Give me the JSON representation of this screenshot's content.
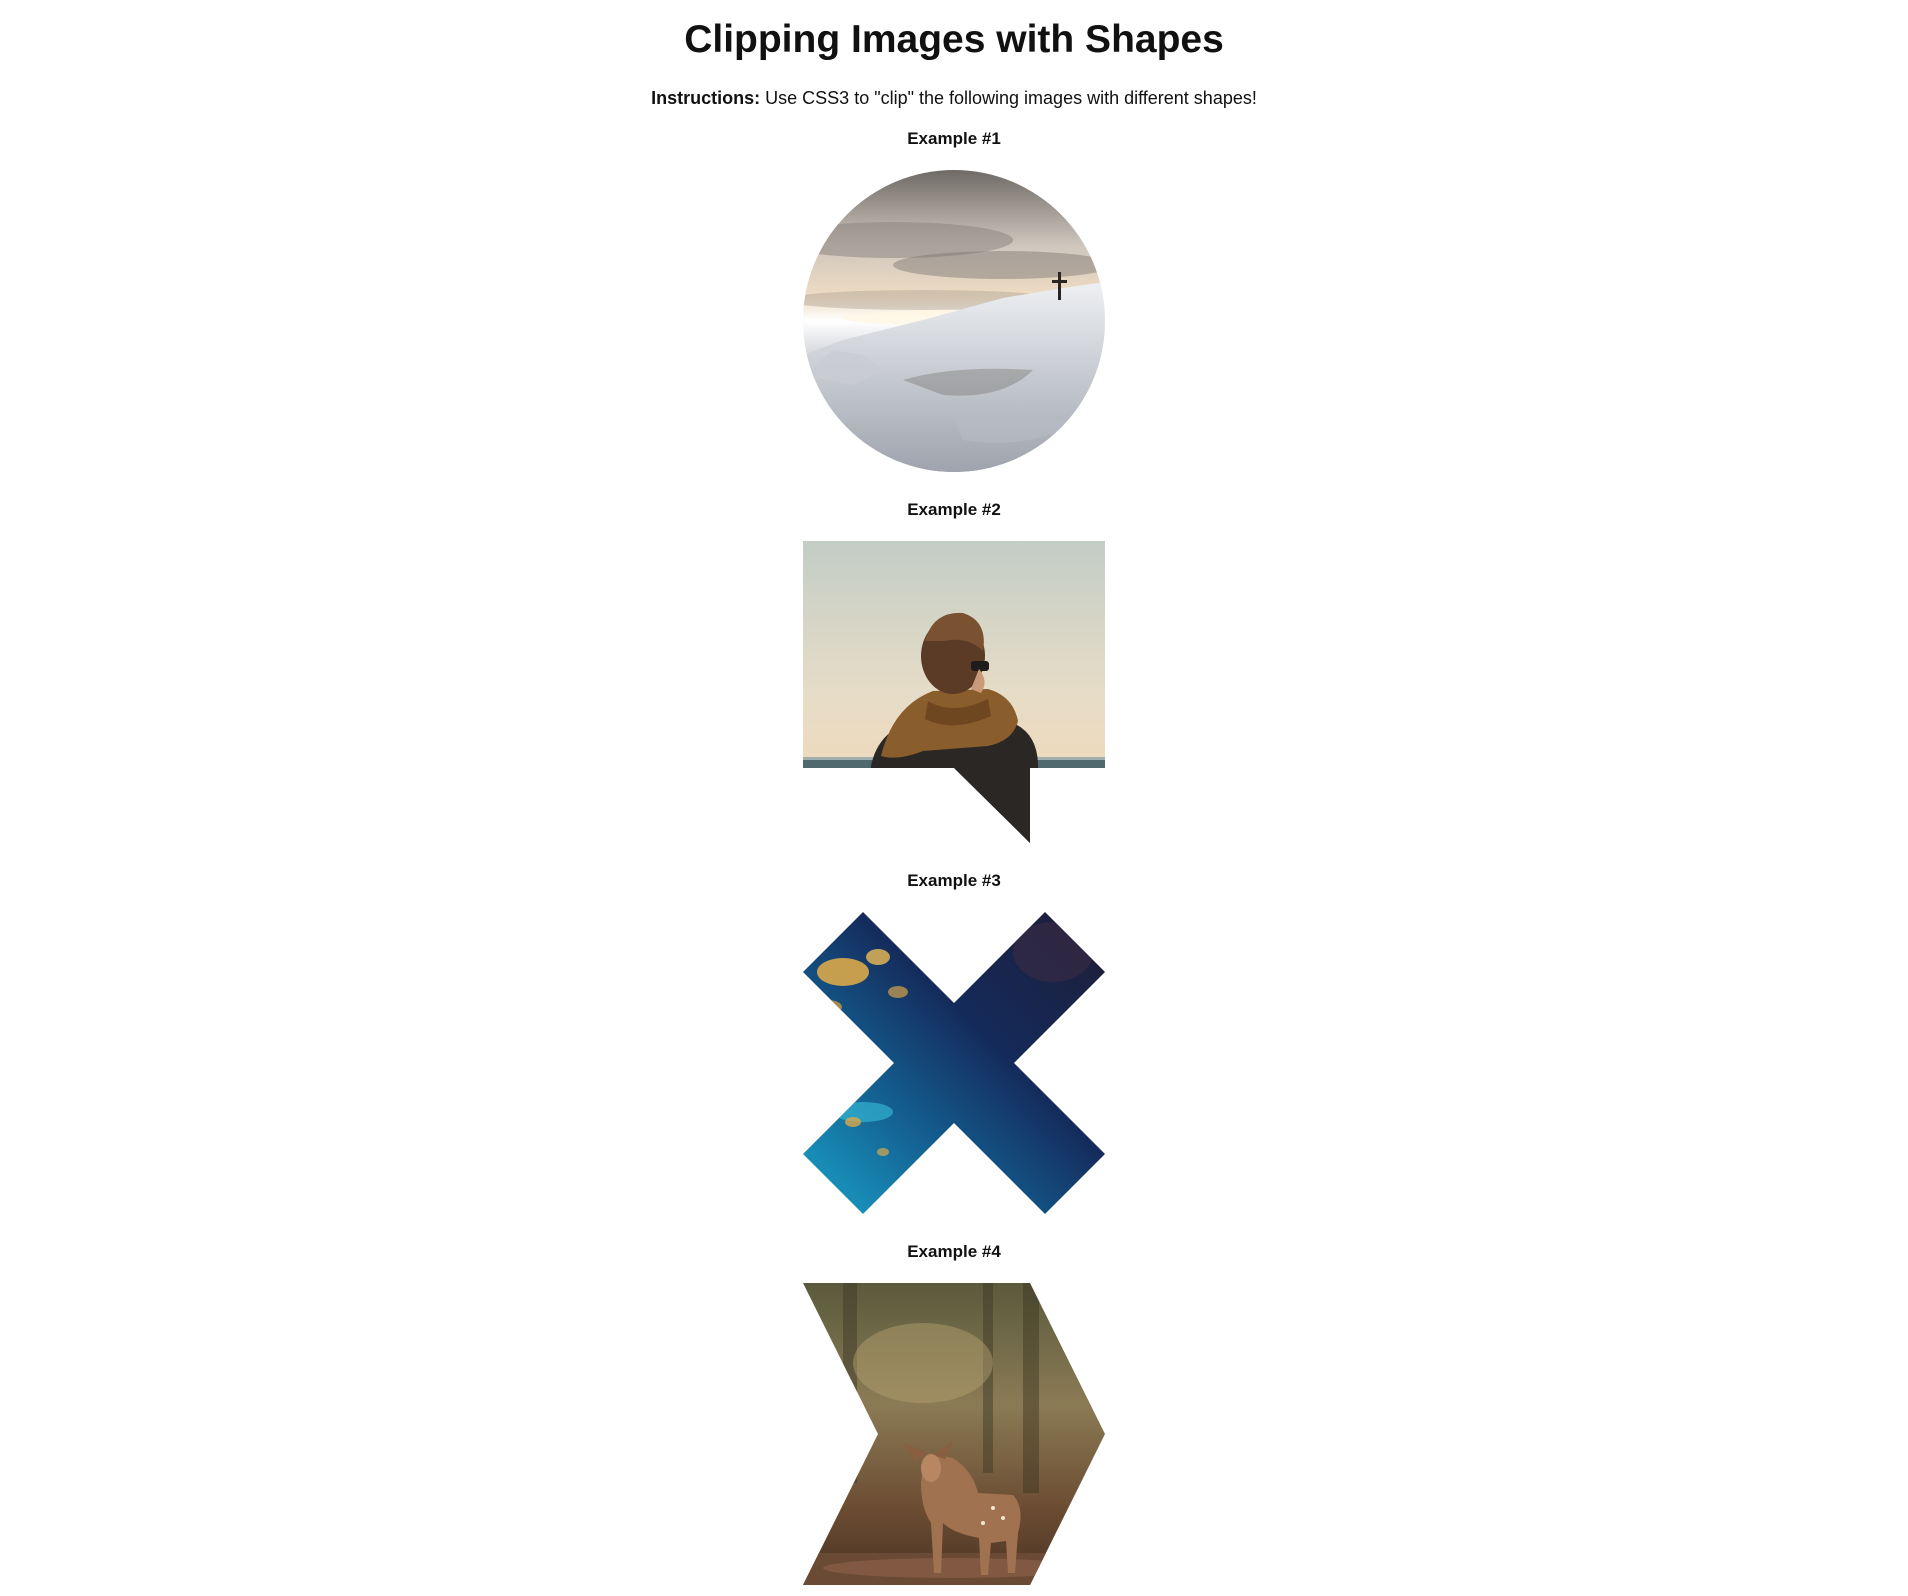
{
  "page": {
    "title": "Clipping Images with Shapes",
    "instructions_label": "Instructions:",
    "instructions_text": " Use CSS3 to \"clip\" the following images with different shapes!"
  },
  "examples": [
    {
      "label": "Example #1",
      "shape": "circle",
      "image": "snowy-mountain-cross-photo"
    },
    {
      "label": "Example #2",
      "shape": "speech-bubble",
      "image": "person-with-scarf-at-sea-photo"
    },
    {
      "label": "Example #3",
      "shape": "x-cross",
      "image": "earth-ocean-from-space-photo"
    },
    {
      "label": "Example #4",
      "shape": "chevron-right",
      "image": "deer-in-forest-photo"
    }
  ]
}
